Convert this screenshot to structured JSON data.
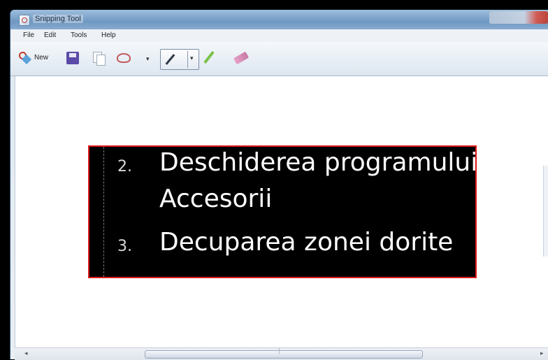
{
  "window": {
    "title": "Snipping Tool"
  },
  "menu": {
    "items": [
      "File",
      "Edit",
      "Tools",
      "Help"
    ]
  },
  "toolbar": {
    "new_label": "New",
    "icons": [
      "new-snip-icon",
      "save-icon",
      "copy-icon",
      "send-snip-icon",
      "dropdown-arrow",
      "pen-icon",
      "highlighter-icon",
      "eraser-icon"
    ]
  },
  "snip": {
    "border_color": "#e01a1a",
    "background": "#000000",
    "items": [
      {
        "number": "2.",
        "line1": "Deschiderea programului",
        "line2": "Accesorii"
      },
      {
        "number": "3.",
        "line1": "Decuparea zonei dorite"
      }
    ]
  }
}
